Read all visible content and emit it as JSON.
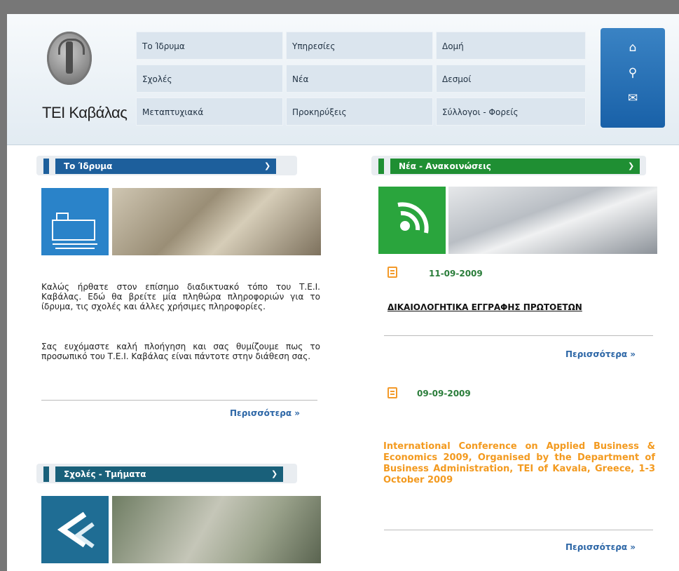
{
  "logo": {
    "text": "TEI Καβάλας"
  },
  "nav": {
    "col1": [
      "Το Ίδρυμα",
      "Σχολές",
      "Μεταπτυχιακά"
    ],
    "col2": [
      "Υπηρεσίες",
      "Νέα",
      "Προκηρύξεις"
    ],
    "col3": [
      "Δομή",
      "Δεσμοί",
      "Σύλλογοι - Φορείς"
    ]
  },
  "quick_icons": [
    "home-icon",
    "search-icon",
    "mail-icon"
  ],
  "left_box": {
    "title": "Το Ίδρυμα",
    "para1": "Καλώς ήρθατε στον επίσημο διαδικτυακό τόπο του Τ.Ε.Ι. Καβάλας. Εδώ θα βρείτε μία πληθώρα πληροφοριών για το ίδρυμα, τις σχολές και άλλες χρήσιμες πληροφορίες.",
    "para2": "Σας ευχόμαστε καλή πλοήγηση και σας θυμίζουμε πως το προσωπικό του Τ.Ε.Ι. Καβάλας είναι πάντοτε στην διάθεση σας.",
    "more": "Περισσότερα »"
  },
  "left_box2": {
    "title": "Σχολές - Τμήματα"
  },
  "news_box": {
    "title": "Νέα - Ανακοινώσεις",
    "items": [
      {
        "date": "11-09-2009",
        "title": "ΔΙΚΑΙΟΛΟΓΗΤΙΚΑ ΕΓΓΡΑΦΗΣ ΠΡΩΤΟΕΤΩΝ",
        "more": "Περισσότερα »"
      },
      {
        "date": "09-09-2009",
        "title": "International Conference on Applied Business & Economics 2009, Organised by the Department of Business Administration, TEI of Kavala, Greece, 1-3 October 2009",
        "more": "Περισσότερα »"
      }
    ]
  },
  "colors": {
    "blue": "#1d5f9c",
    "green": "#1f8f33",
    "orange": "#f39a1f",
    "link": "#2c66a6"
  }
}
